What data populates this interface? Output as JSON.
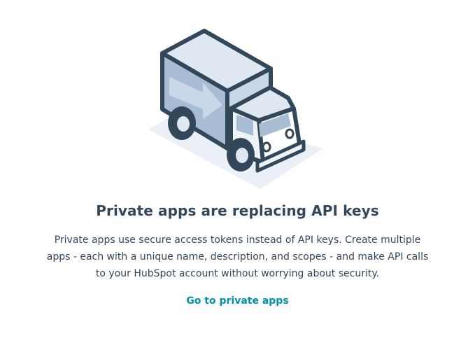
{
  "empty_state": {
    "illustration_icon": "delivery-truck-icon",
    "title": "Private apps are replacing API keys",
    "description": "Private apps use secure access tokens instead of API keys. Create multiple apps - each with a unique name, description, and scopes - and make API calls to your HubSpot account without worrying about security.",
    "cta_label": "Go to private apps",
    "colors": {
      "heading": "#33475b",
      "link": "#0091ae",
      "truck_outline": "#33475b",
      "truck_body": "#c9d7e6",
      "truck_side": "#9fb4ce",
      "shadow": "#eaf0f6"
    }
  }
}
